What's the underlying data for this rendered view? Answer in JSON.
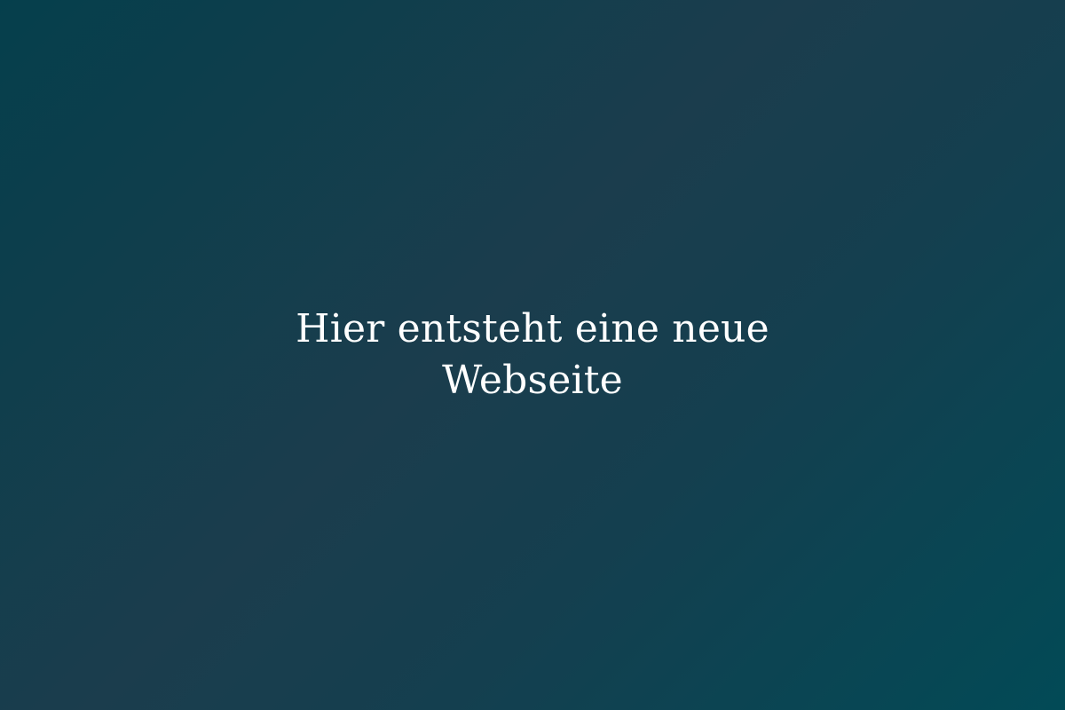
{
  "page": {
    "headline": "Hier entsteht eine neue Webseite"
  },
  "colors": {
    "background_start": "#053f4c",
    "background_mid": "#1b3d4d",
    "background_end": "#024a56",
    "text": "#ffffff"
  }
}
